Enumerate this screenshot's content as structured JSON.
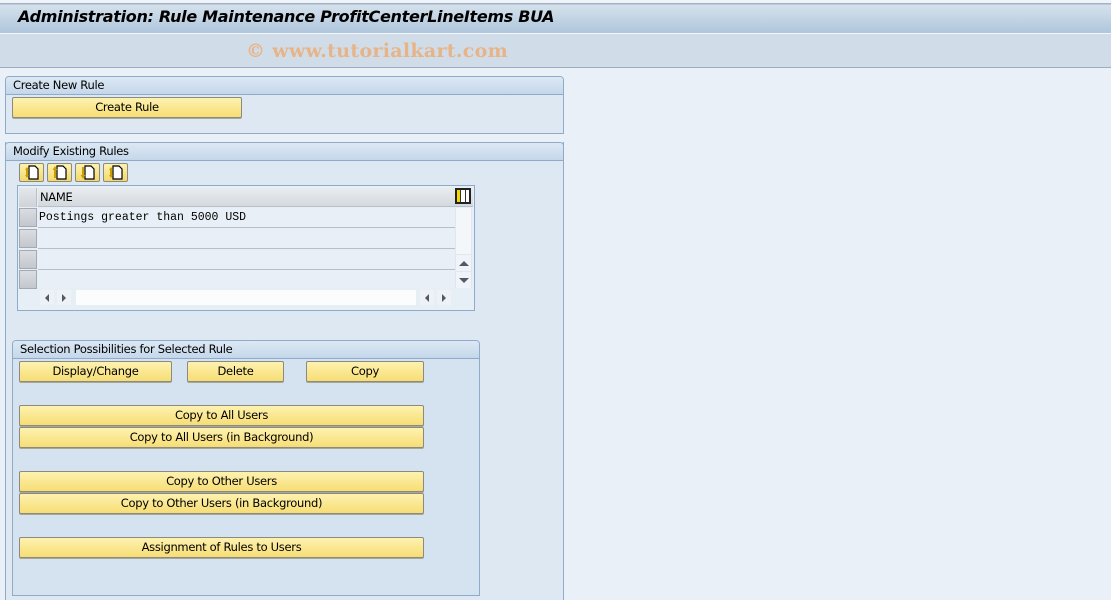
{
  "window": {
    "title": "Administration: Rule Maintenance ProfitCenterLineItems BUA",
    "watermark": "© www.tutorialkart.com"
  },
  "create_group": {
    "title": "Create New Rule",
    "create_button": "Create Rule"
  },
  "modify_group": {
    "title": "Modify Existing Rules",
    "toolbar_icons": [
      {
        "name": "upload-icon",
        "tooltip": ""
      },
      {
        "name": "move-up-icon",
        "tooltip": ""
      },
      {
        "name": "move-down-icon",
        "tooltip": ""
      },
      {
        "name": "download-icon",
        "tooltip": ""
      }
    ],
    "table": {
      "columns": [
        "NAME"
      ],
      "rows": [
        {
          "name": "Postings greater than 5000 USD"
        },
        {
          "name": ""
        },
        {
          "name": ""
        },
        {
          "name": ""
        }
      ]
    }
  },
  "selection_group": {
    "title": "Selection Possibilities for Selected Rule",
    "buttons": {
      "display_change": "Display/Change",
      "delete": "Delete",
      "copy": "Copy",
      "copy_all_users": "Copy to All Users",
      "copy_all_users_bg": "Copy to All Users (in Background)",
      "copy_other_users": "Copy to Other Users",
      "copy_other_users_bg": "Copy to Other Users (in Background)",
      "assignment": "Assignment of Rules to Users"
    }
  },
  "colors": {
    "button_fill": "#f7dd74",
    "group_border": "#90abc9",
    "background": "#e9f0f7",
    "watermark": "#e7b489"
  }
}
